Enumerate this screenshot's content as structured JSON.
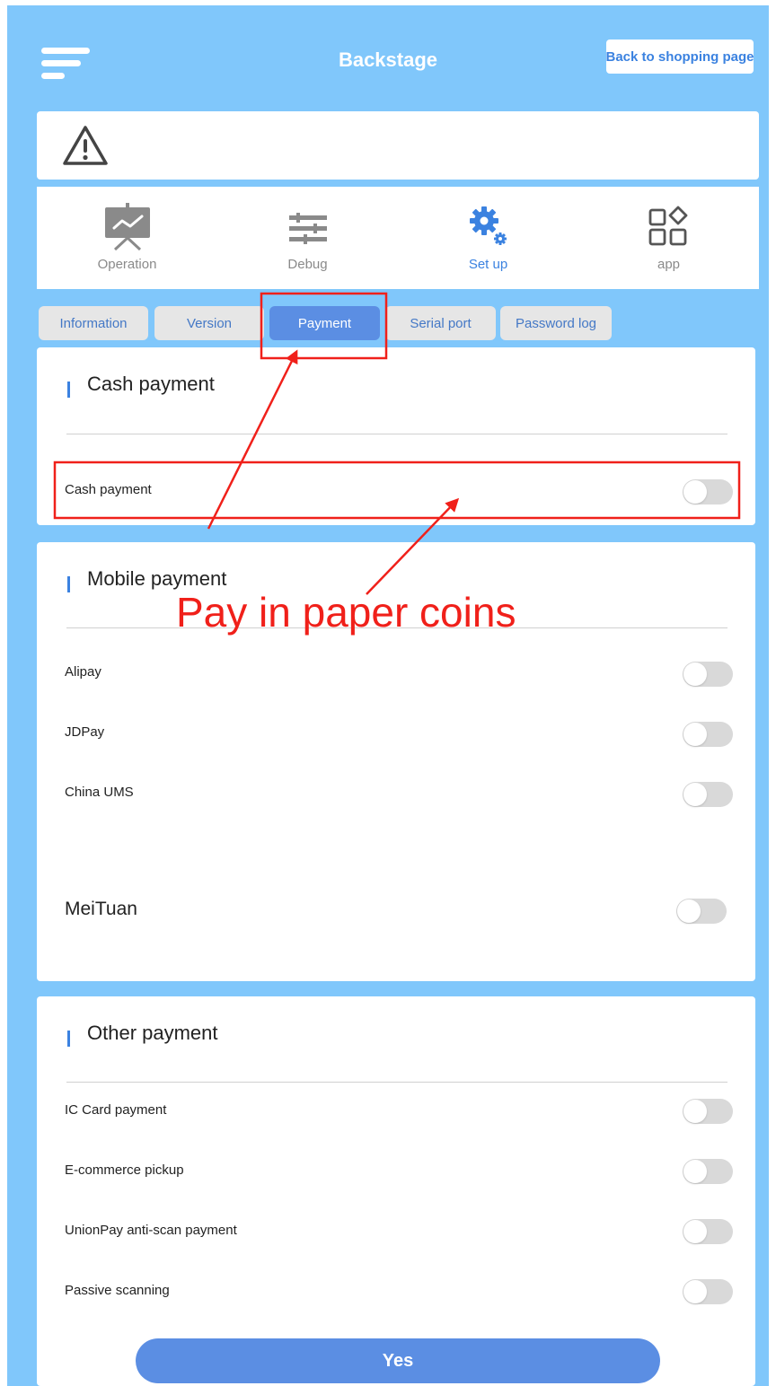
{
  "header": {
    "title": "Backstage",
    "back_button": "Back to shopping page"
  },
  "nav": {
    "items": [
      {
        "label": "Operation",
        "icon": "presentation-chart-icon"
      },
      {
        "label": "Debug",
        "icon": "sliders-icon"
      },
      {
        "label": "Set up",
        "icon": "gears-icon"
      },
      {
        "label": "app",
        "icon": "app-grid-icon"
      }
    ],
    "active_index": 2
  },
  "tabs": [
    {
      "label": "Information"
    },
    {
      "label": "Version"
    },
    {
      "label": "Payment"
    },
    {
      "label": "Serial port"
    },
    {
      "label": "Password log"
    }
  ],
  "active_tab": 2,
  "sections": {
    "cash": {
      "title": "Cash payment",
      "rows": [
        {
          "label": "Cash payment",
          "enabled": false
        }
      ]
    },
    "mobile": {
      "title": "Mobile payment",
      "rows": [
        {
          "label": "Alipay",
          "enabled": false
        },
        {
          "label": "JDPay",
          "enabled": false
        },
        {
          "label": "China UMS",
          "enabled": false
        },
        {
          "label": "MeiTuan",
          "enabled": false
        }
      ]
    },
    "other": {
      "title": "Other payment",
      "rows": [
        {
          "label": "IC Card payment",
          "enabled": false
        },
        {
          "label": "E-commerce pickup",
          "enabled": false
        },
        {
          "label": "UnionPay anti-scan payment",
          "enabled": false
        },
        {
          "label": "Passive scanning",
          "enabled": false
        }
      ]
    }
  },
  "confirm_button": "Yes",
  "annotation": {
    "text": "Pay in paper coins",
    "color": "#f0201a"
  },
  "colors": {
    "background": "#80c7fb",
    "accent": "#5b8ee3",
    "link": "#3b82e0"
  }
}
